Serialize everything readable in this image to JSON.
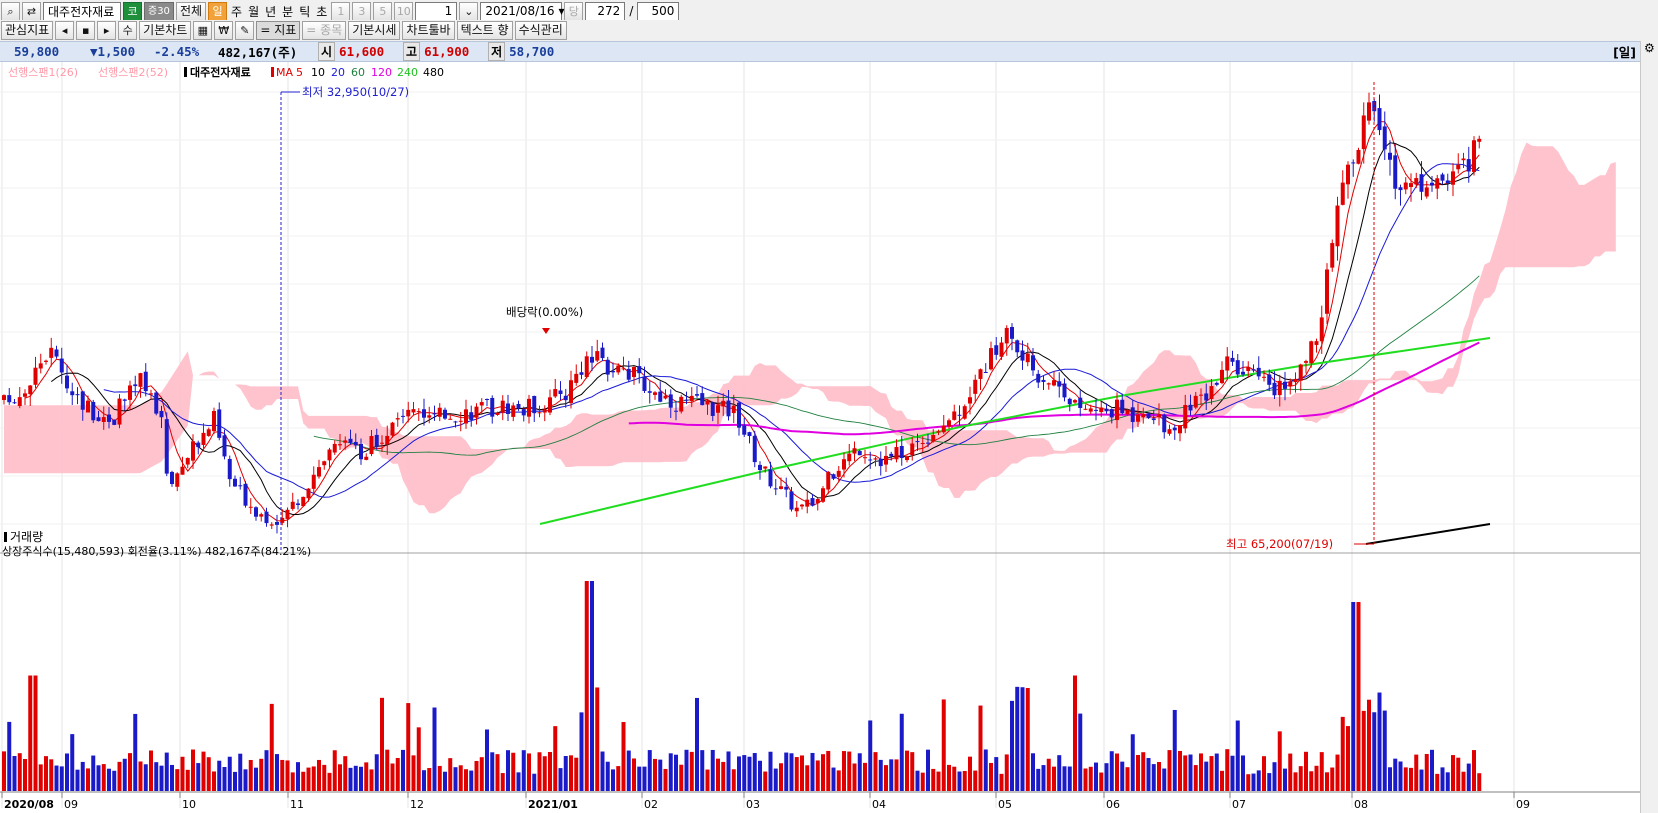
{
  "toolbar1": {
    "stock_name": "대주전자재료",
    "market_badge": "코",
    "chart_badge": "증30",
    "all_label": "전체",
    "day_label": "일",
    "week_label": "주",
    "month_label": "월",
    "year_label": "년",
    "minute_label": "분",
    "tick_label": "틱",
    "second_label": "초",
    "period_1": "1",
    "period_3": "3",
    "period_5": "5",
    "period_10": "10",
    "period_value": "1",
    "date_value": "2021/08/16",
    "dang_label": "당",
    "count_value": "272",
    "slash": "/",
    "max_value": "500"
  },
  "toolbar2": {
    "watch_label": "관심지표",
    "su_label": "수",
    "basic_chart_label": "기본차트",
    "won_label": "₩",
    "indicator_label": "= 지표",
    "item_label": "= 종목",
    "basic_price_label": "기본시세",
    "chart_toolbar_label": "차트툴바",
    "text_label": "텍스트 향",
    "formula_label": "수식관리"
  },
  "price_bar": {
    "current": "59,800",
    "change": "▼1,500",
    "change_pct": "-2.45%",
    "volume": "482,167(주)",
    "open_label": "시",
    "open": "61,600",
    "high_label": "고",
    "high": "61,900",
    "low_label": "저",
    "low": "58,700",
    "period_label": "[일]"
  },
  "legend": {
    "span1": "선행스팬1(26)",
    "span2": "선행스팬2(52)",
    "name": "대주전자재료",
    "ma_label": "MA",
    "ma_periods": [
      "5",
      "10",
      "20",
      "60",
      "120",
      "240",
      "480"
    ]
  },
  "annotations": {
    "low": "최저  32,950(10/27)",
    "high": "최고  65,200(07/19)",
    "dividend": "배당락(0.00%)"
  },
  "volume_panel": {
    "title": "거래량",
    "info": "상장주식수(15,480,593) 회전율(3.11%) 482,167주(84.21%)"
  },
  "x_axis": {
    "labels": [
      "2020/08",
      "09",
      "10",
      "11",
      "12",
      "2021/01",
      "02",
      "03",
      "04",
      "05",
      "06",
      "07",
      "08",
      "09"
    ]
  },
  "colors": {
    "up": "#e00000",
    "down": "#1a1ac8",
    "cloud": "#ffc0cb",
    "ma5": "#e00000",
    "ma10": "#000000",
    "ma20": "#1a1ad8",
    "ma60": "#208040",
    "ma120": "#e000e0",
    "ma240": "#20dd20",
    "ma480": "#000000"
  },
  "chart_data": {
    "type": "candlestick",
    "price_anchors": [
      [
        "2020-08",
        41500
      ],
      [
        "2020-09",
        43500
      ],
      [
        "2020-10",
        37500
      ],
      [
        "2020-10-27",
        32950
      ],
      [
        "2020-11",
        38000
      ],
      [
        "2020-12",
        40500
      ],
      [
        "2021-01",
        43500
      ],
      [
        "2021-02",
        42000
      ],
      [
        "2021-03-18",
        33500
      ],
      [
        "2021-04",
        38500
      ],
      [
        "2021-05",
        44500
      ],
      [
        "2021-06",
        40000
      ],
      [
        "2021-07-19",
        65200
      ],
      [
        "2021-08-16",
        59800
      ]
    ],
    "volume_note": "Largest volume spike early January 2021, second largest mid July 2021"
  }
}
